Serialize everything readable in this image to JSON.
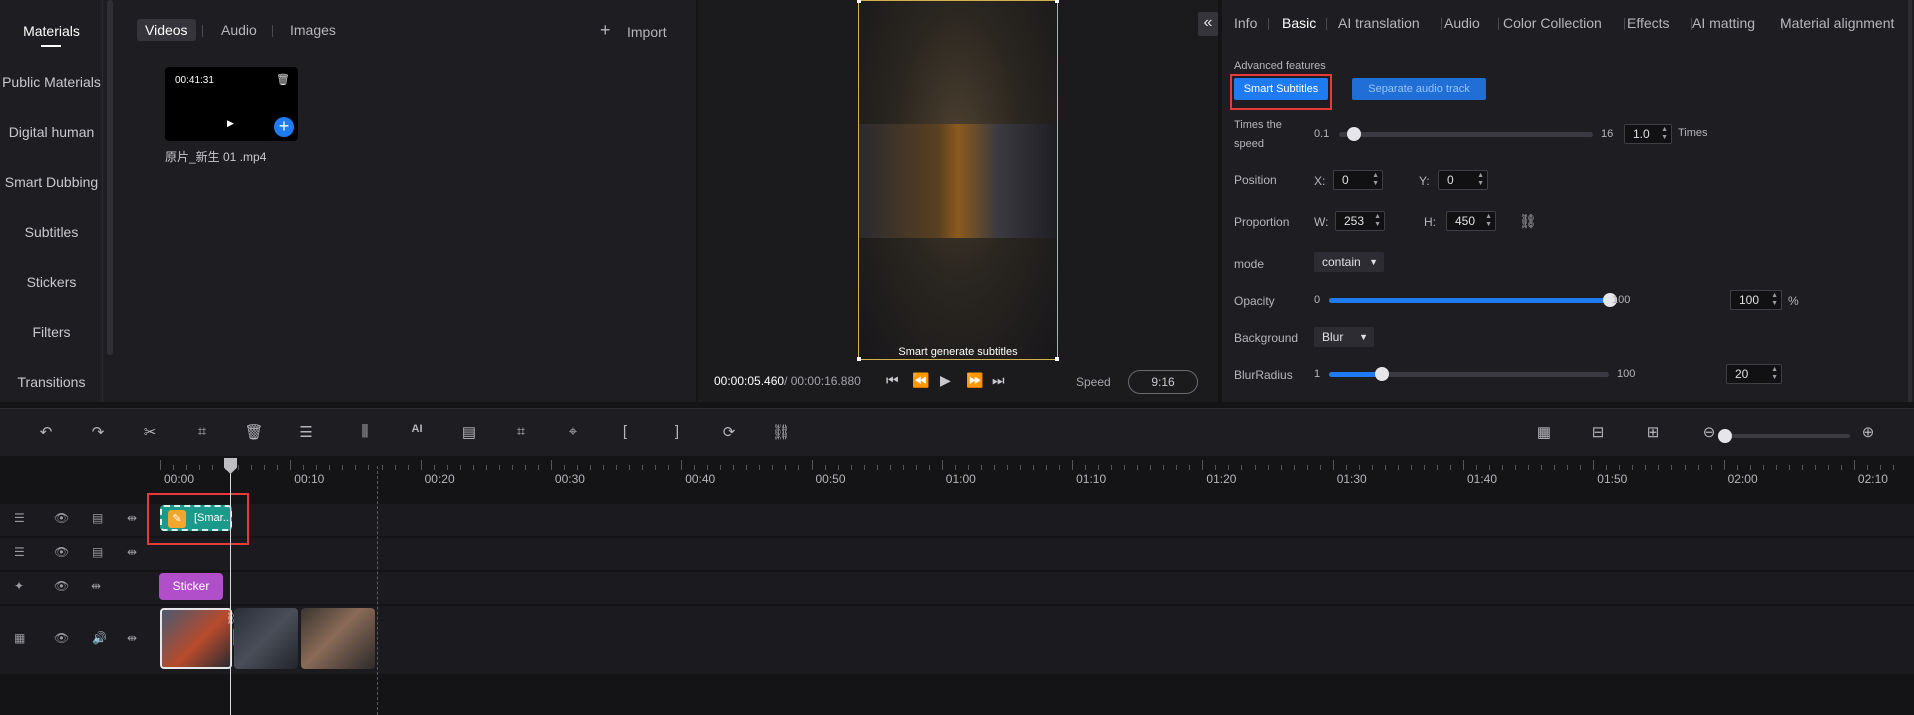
{
  "sidebar": {
    "items": [
      "Materials",
      "Public Materials",
      "Digital human",
      "Smart Dubbing",
      "Subtitles",
      "Stickers",
      "Filters",
      "Transitions"
    ]
  },
  "media": {
    "tabs": [
      "Videos",
      "Audio",
      "Images"
    ],
    "import_label": "Import",
    "file": {
      "duration": "00:41:31",
      "name": "原片_新生 01 .mp4"
    }
  },
  "preview": {
    "caption": "Smart generate subtitles",
    "current_time": "00:00:05.460",
    "total_time": "/ 00:00:16.880",
    "speed_label": "Speed",
    "ratio": "9:16"
  },
  "props": {
    "tabs": [
      "Info",
      "Basic",
      "AI translation",
      "Audio",
      "Color Collection",
      "Effects",
      "AI matting",
      "Material alignment"
    ],
    "active_tab": "Basic",
    "advanced_label": "Advanced features",
    "smart_subtitles": "Smart Subtitles",
    "separate_audio": "Separate audio track",
    "speed": {
      "label_1": "Times the",
      "label_2": "speed",
      "min": "0.1",
      "max": "16",
      "value": "1.0",
      "unit": "Times",
      "level": 0.06
    },
    "position": {
      "label": "Position",
      "x_label": "X:",
      "x": "0",
      "y_label": "Y:",
      "y": "0"
    },
    "proportion": {
      "label": "Proportion",
      "w_label": "W:",
      "w": "253",
      "h_label": "H:",
      "h": "450"
    },
    "mode": {
      "label": "mode",
      "value": "contain"
    },
    "opacity": {
      "label": "Opacity",
      "min": "0",
      "max": "100",
      "value": "100",
      "unit": "%",
      "level": 1.0
    },
    "background": {
      "label": "Background",
      "value": "Blur"
    },
    "blur": {
      "label": "BlurRadius",
      "min": "1",
      "max": "100",
      "value": "20",
      "level": 0.19
    }
  },
  "toolbar": {
    "tools": [
      "undo-icon",
      "redo-icon",
      "split-icon",
      "crop-icon",
      "delete-icon",
      "text-align-icon",
      "audio-wave-icon",
      "ai-icon",
      "subtitle-icon",
      "crop-frame-icon",
      "location-icon",
      "bracket-left-icon",
      "bracket-right-icon",
      "speed-icon",
      "link-icon"
    ],
    "ai_label": "AI",
    "bracket_left": "[",
    "bracket_right": "]"
  },
  "timeline": {
    "ruler": [
      "00:00",
      "00:10",
      "00:20",
      "00:30",
      "00:40",
      "00:50",
      "01:00",
      "01:10",
      "01:20",
      "01:30",
      "01:40",
      "01:50",
      "02:00",
      "02:10"
    ],
    "subtitle_clip": "[Smar...",
    "sticker_clip": "Sticker"
  },
  "colors": {
    "accent": "#1f7bf2",
    "highlight": "#e83a3a",
    "subtitle_clip": "#1a9a8a",
    "sticker_clip": "#b04fc9"
  }
}
